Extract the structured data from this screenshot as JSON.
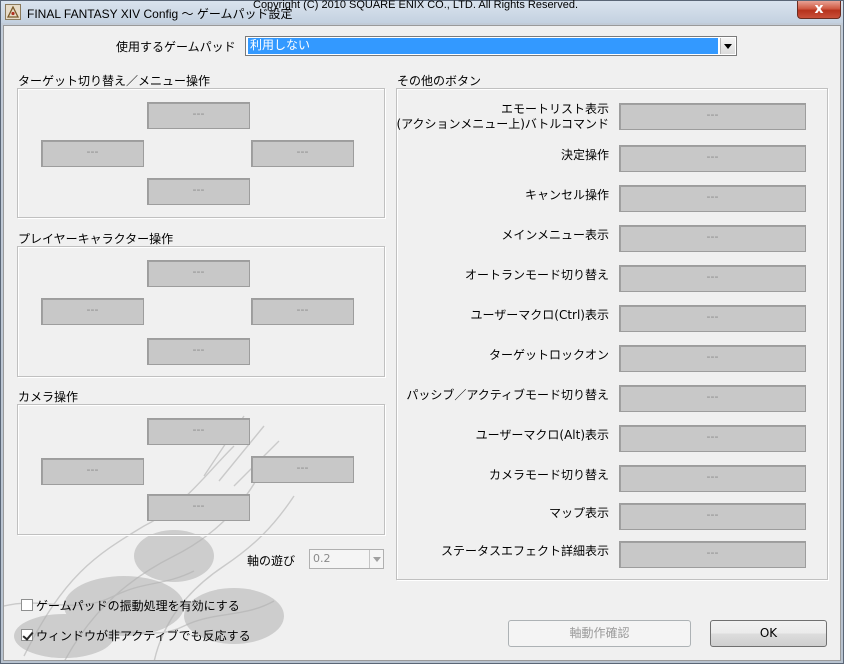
{
  "window": {
    "title": "FINAL FANTASY XIV Config ～ ゲームパッド設定",
    "copyright": "Copyright (C) 2010 SQUARE ENIX CO., LTD. All Rights Reserved.",
    "close_label": "x"
  },
  "gamepad": {
    "label": "使用するゲームパッド",
    "selected": "利用しない"
  },
  "target_group": {
    "title": "ターゲット切り替え／メニュー操作",
    "up": "---",
    "left": "---",
    "right": "---",
    "down": "---"
  },
  "player_group": {
    "title": "プレイヤーキャラクター操作",
    "up": "---",
    "left": "---",
    "right": "---",
    "down": "---"
  },
  "camera_group": {
    "title": "カメラ操作",
    "up": "---",
    "left": "---",
    "right": "---",
    "down": "---"
  },
  "axis": {
    "label": "軸の遊び",
    "value": "0.2"
  },
  "other_buttons": {
    "title": "その他のボタン",
    "rows": [
      {
        "label": "エモートリスト表示\n(アクションメニュー上)バトルコマンド",
        "value": "---"
      },
      {
        "label": "決定操作",
        "value": "---"
      },
      {
        "label": "キャンセル操作",
        "value": "---"
      },
      {
        "label": "メインメニュー表示",
        "value": "---"
      },
      {
        "label": "オートランモード切り替え",
        "value": "---"
      },
      {
        "label": "ユーザーマクロ(Ctrl)表示",
        "value": "---"
      },
      {
        "label": "ターゲットロックオン",
        "value": "---"
      },
      {
        "label": "パッシブ／アクティブモード切り替え",
        "value": "---"
      },
      {
        "label": "ユーザーマクロ(Alt)表示",
        "value": "---"
      },
      {
        "label": "カメラモード切り替え",
        "value": "---"
      },
      {
        "label": "マップ表示",
        "value": "---"
      },
      {
        "label": "ステータスエフェクト詳細表示",
        "value": "---"
      }
    ]
  },
  "options": {
    "vibration_label": "ゲームパッドの振動処理を有効にする",
    "vibration_checked": false,
    "inactive_label": "ウィンドウが非アクティブでも反応する",
    "inactive_checked": true
  },
  "buttons": {
    "test_label": "軸動作確認",
    "ok_label": "OK"
  }
}
